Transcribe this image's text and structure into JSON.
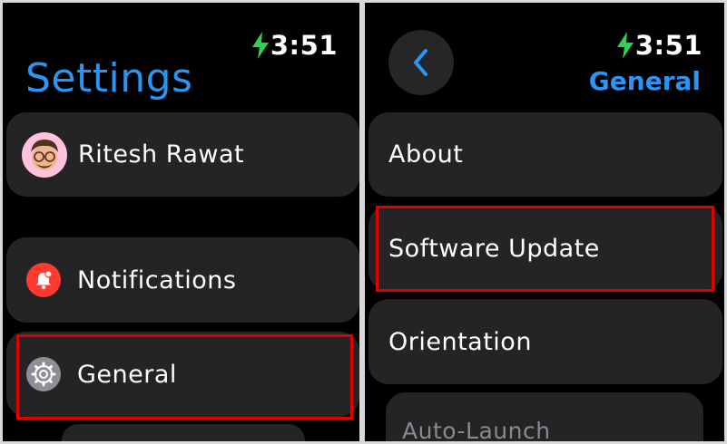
{
  "left": {
    "time": "3:51",
    "title": "Settings",
    "profile": {
      "name": "Ritesh Rawat"
    },
    "items": [
      {
        "label": "Notifications",
        "icon": "bell-icon"
      },
      {
        "label": "General",
        "icon": "gear-icon"
      }
    ]
  },
  "right": {
    "time": "3:51",
    "title": "General",
    "items": [
      {
        "label": "About"
      },
      {
        "label": "Software Update"
      },
      {
        "label": "Orientation"
      },
      {
        "label": "Auto-Launch"
      }
    ]
  },
  "colors": {
    "accent": "#2a95f5",
    "charging_bolt": "#30d158",
    "notifications_icon_bg": "#ff3b30",
    "highlight_border": "#e00000"
  }
}
